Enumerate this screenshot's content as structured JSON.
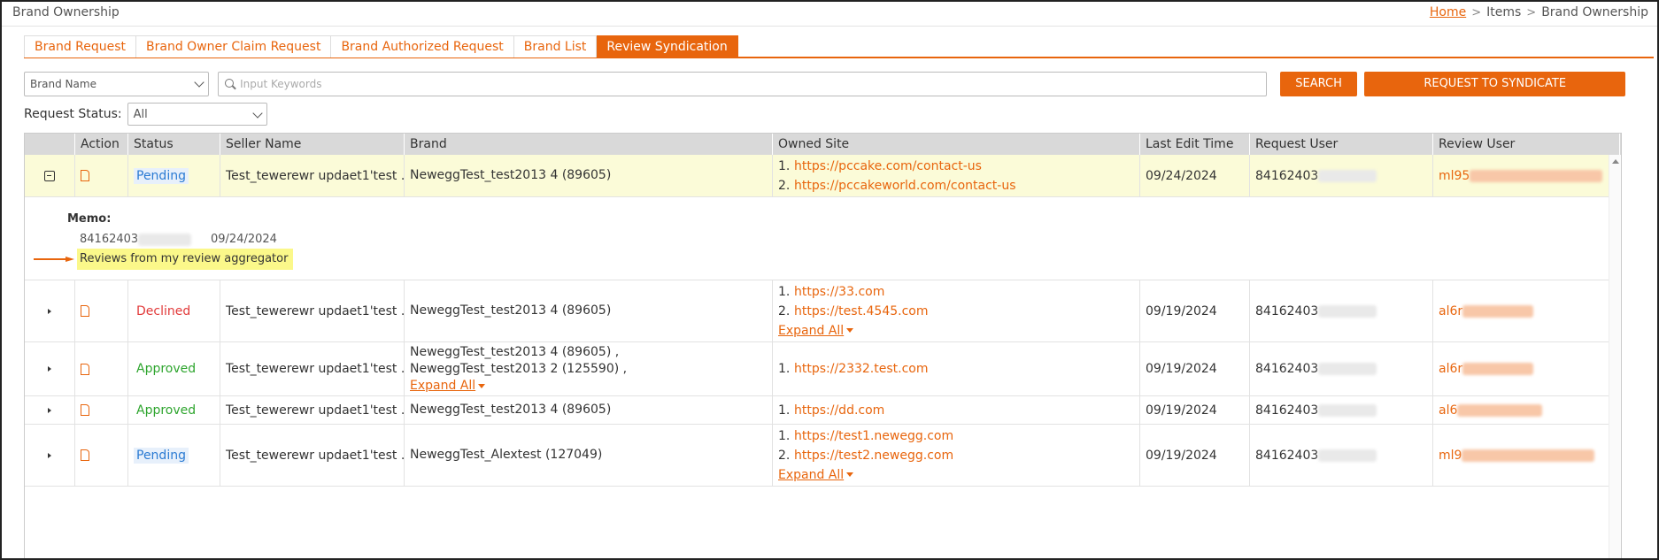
{
  "page": {
    "title": "Brand Ownership",
    "breadcrumb": {
      "home": "Home",
      "sep": ">",
      "items": "Items",
      "current": "Brand Ownership"
    }
  },
  "tabs": [
    {
      "label": "Brand Request",
      "active": false
    },
    {
      "label": "Brand Owner Claim Request",
      "active": false
    },
    {
      "label": "Brand Authorized Request",
      "active": false
    },
    {
      "label": "Brand List",
      "active": false
    },
    {
      "label": "Review Syndication",
      "active": true
    }
  ],
  "filters": {
    "field_select": "Brand Name",
    "search_placeholder": "Input Keywords",
    "search_button": "SEARCH",
    "syndicate_button": "REQUEST TO SYNDICATE",
    "status_label": "Request Status:",
    "status_value": "All"
  },
  "table": {
    "headers": [
      "Action",
      "Status",
      "Seller Name",
      "Brand",
      "Owned Site",
      "Last Edit Time",
      "Request User",
      "Review User"
    ],
    "expand_all": "Expand All",
    "rows": [
      {
        "status": "Pending",
        "seller": "Test_tewerewr updaet1'test ...",
        "brand": [
          "NeweggTest_test2013 4 (89605)"
        ],
        "sites": [
          "https://pccake.com/contact-us",
          "https://pccakeworld.com/contact-us"
        ],
        "time": "09/24/2024",
        "req_user": "84162403",
        "rev_user": "ml95"
      },
      {
        "status": "Declined",
        "seller": "Test_tewerewr updaet1'test ...",
        "brand": [
          "NeweggTest_test2013 4 (89605)"
        ],
        "sites": [
          "https://33.com",
          "https://test.4545.com"
        ],
        "time": "09/19/2024",
        "req_user": "84162403",
        "rev_user": "al6r"
      },
      {
        "status": "Approved",
        "seller": "Test_tewerewr updaet1'test ...",
        "brand": [
          "NeweggTest_test2013 4 (89605) ,",
          "NeweggTest_test2013 2 (125590) ,"
        ],
        "sites": [
          "https://2332.test.com"
        ],
        "time": "09/19/2024",
        "req_user": "84162403",
        "rev_user": "al6r"
      },
      {
        "status": "Approved",
        "seller": "Test_tewerewr updaet1'test ...",
        "brand": [
          "NeweggTest_test2013 4 (89605)"
        ],
        "sites": [
          "https://dd.com"
        ],
        "time": "09/19/2024",
        "req_user": "84162403",
        "rev_user": "al6"
      },
      {
        "status": "Pending",
        "seller": "Test_tewerewr updaet1'test ...",
        "brand": [
          "NeweggTest_Alextest (127049)"
        ],
        "sites": [
          "https://test1.newegg.com",
          "https://test2.newegg.com"
        ],
        "time": "09/19/2024",
        "req_user": "84162403",
        "rev_user": "ml9"
      }
    ],
    "memo": {
      "title": "Memo:",
      "user": "84162403",
      "date": "09/24/2024",
      "text": "Reviews from my review aggregator"
    }
  },
  "colors": {
    "accent": "#e8650d",
    "highlight_row": "#fbfbd8",
    "memo_highlight": "#fbf88a"
  }
}
